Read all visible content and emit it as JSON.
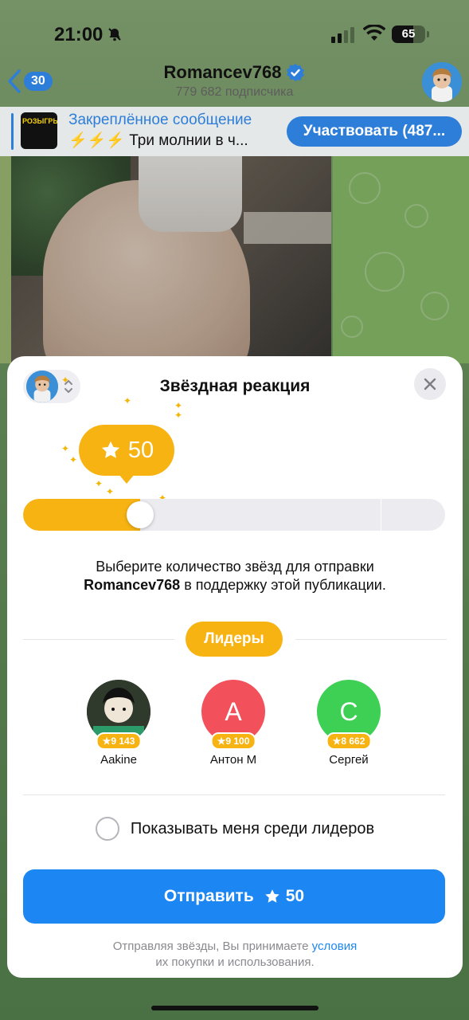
{
  "status_bar": {
    "time": "21:00",
    "battery": "65",
    "battery_level": 0.65
  },
  "nav": {
    "back_count": "30",
    "channel_name": "Romancev768",
    "subscribers": "779 682 подписчика"
  },
  "pinned": {
    "title": "Закреплённое сообщение",
    "text": "⚡⚡⚡ Три молнии в ч...",
    "thumb_text": "РОЗЫГРЫШ",
    "button": "Участвовать (487..."
  },
  "sheet": {
    "title": "Звёздная реакция",
    "star_amount": "50",
    "slider_fraction": 0.24,
    "description_line1": "Выберите количество звёзд для отправки",
    "description_bold": "Romancev768",
    "description_line2_rest": " в поддержку этой публикации.",
    "leaders_label": "Лидеры",
    "leaders": [
      {
        "name": "Aakine",
        "stars": "9 143",
        "avatar_letter": "",
        "avatar_color": "#2f3a2c"
      },
      {
        "name": "Антон М",
        "stars": "9 100",
        "avatar_letter": "А",
        "avatar_color": "#f2505a"
      },
      {
        "name": "Сергей",
        "stars": "8 662",
        "avatar_letter": "С",
        "avatar_color": "#3ecf55"
      }
    ],
    "show_me_label": "Показывать меня среди лидеров",
    "send_button_prefix": "Отправить",
    "send_button_amount": "50",
    "terms_before": "Отправляя звёзды, Вы принимаете ",
    "terms_link": "условия",
    "terms_after": "их покупки и использования."
  },
  "colors": {
    "accent": "#1c86f2",
    "star": "#f7b312",
    "telegram_blue": "#2d7ed8"
  }
}
